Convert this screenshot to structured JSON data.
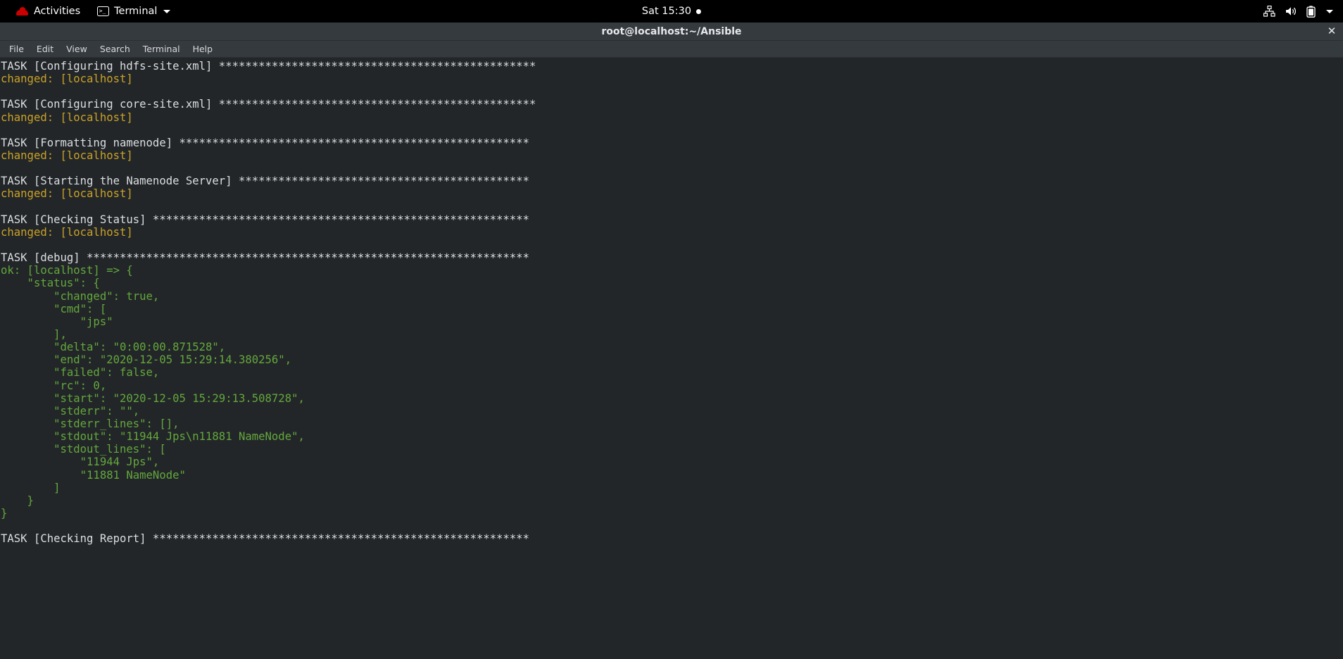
{
  "topbar": {
    "activities_label": "Activities",
    "app_menu_label": "Terminal",
    "app_icon": "terminal-icon",
    "distro_icon": "redhat-logo-icon",
    "clock": "Sat 15:30",
    "notification_indicator": "notification-dot",
    "status_icons": [
      "network-wired-icon",
      "volume-icon",
      "battery-icon",
      "chevron-down-icon"
    ],
    "background": "#000000"
  },
  "window": {
    "title": "root@localhost:~/Ansible",
    "close_label": "✕",
    "titlebar_background": "#353a3f"
  },
  "menubar": {
    "items": [
      {
        "label": "File"
      },
      {
        "label": "Edit"
      },
      {
        "label": "View"
      },
      {
        "label": "Search"
      },
      {
        "label": "Terminal"
      },
      {
        "label": "Help"
      }
    ]
  },
  "terminal": {
    "background": "#232629",
    "colors": {
      "default": "#d0d0d0",
      "task_header": "#dcdfe1",
      "changed": "#c9a227",
      "ok_debug": "#63a83c"
    },
    "lines": [
      {
        "segments": [
          {
            "text": "TASK [Configuring hdfs-site.xml] ************************************************",
            "color": "white"
          }
        ]
      },
      {
        "segments": [
          {
            "text": "changed: [localhost]",
            "color": "yellow"
          }
        ]
      },
      {
        "segments": [
          {
            "text": "",
            "color": "blank"
          }
        ]
      },
      {
        "segments": [
          {
            "text": "TASK [Configuring core-site.xml] ************************************************",
            "color": "white"
          }
        ]
      },
      {
        "segments": [
          {
            "text": "changed: [localhost]",
            "color": "yellow"
          }
        ]
      },
      {
        "segments": [
          {
            "text": "",
            "color": "blank"
          }
        ]
      },
      {
        "segments": [
          {
            "text": "TASK [Formatting namenode] *****************************************************",
            "color": "white"
          }
        ]
      },
      {
        "segments": [
          {
            "text": "changed: [localhost]",
            "color": "yellow"
          }
        ]
      },
      {
        "segments": [
          {
            "text": "",
            "color": "blank"
          }
        ]
      },
      {
        "segments": [
          {
            "text": "TASK [Starting the Namenode Server] ********************************************",
            "color": "white"
          }
        ]
      },
      {
        "segments": [
          {
            "text": "changed: [localhost]",
            "color": "yellow"
          }
        ]
      },
      {
        "segments": [
          {
            "text": "",
            "color": "blank"
          }
        ]
      },
      {
        "segments": [
          {
            "text": "TASK [Checking Status] *********************************************************",
            "color": "white"
          }
        ]
      },
      {
        "segments": [
          {
            "text": "changed: [localhost]",
            "color": "yellow"
          }
        ]
      },
      {
        "segments": [
          {
            "text": "",
            "color": "blank"
          }
        ]
      },
      {
        "segments": [
          {
            "text": "TASK [debug] *******************************************************************",
            "color": "white"
          }
        ]
      },
      {
        "segments": [
          {
            "text": "ok: [localhost] => {",
            "color": "green"
          }
        ]
      },
      {
        "segments": [
          {
            "text": "    \"status\": {",
            "color": "green"
          }
        ]
      },
      {
        "segments": [
          {
            "text": "        \"changed\": true,",
            "color": "green"
          }
        ]
      },
      {
        "segments": [
          {
            "text": "        \"cmd\": [",
            "color": "green"
          }
        ]
      },
      {
        "segments": [
          {
            "text": "            \"jps\"",
            "color": "green"
          }
        ]
      },
      {
        "segments": [
          {
            "text": "        ],",
            "color": "green"
          }
        ]
      },
      {
        "segments": [
          {
            "text": "        \"delta\": \"0:00:00.871528\",",
            "color": "green"
          }
        ]
      },
      {
        "segments": [
          {
            "text": "        \"end\": \"2020-12-05 15:29:14.380256\",",
            "color": "green"
          }
        ]
      },
      {
        "segments": [
          {
            "text": "        \"failed\": false,",
            "color": "green"
          }
        ]
      },
      {
        "segments": [
          {
            "text": "        \"rc\": 0,",
            "color": "green"
          }
        ]
      },
      {
        "segments": [
          {
            "text": "        \"start\": \"2020-12-05 15:29:13.508728\",",
            "color": "green"
          }
        ]
      },
      {
        "segments": [
          {
            "text": "        \"stderr\": \"\",",
            "color": "green"
          }
        ]
      },
      {
        "segments": [
          {
            "text": "        \"stderr_lines\": [],",
            "color": "green"
          }
        ]
      },
      {
        "segments": [
          {
            "text": "        \"stdout\": \"11944 Jps\\n11881 NameNode\",",
            "color": "green"
          }
        ]
      },
      {
        "segments": [
          {
            "text": "        \"stdout_lines\": [",
            "color": "green"
          }
        ]
      },
      {
        "segments": [
          {
            "text": "            \"11944 Jps\",",
            "color": "green"
          }
        ]
      },
      {
        "segments": [
          {
            "text": "            \"11881 NameNode\"",
            "color": "green"
          }
        ]
      },
      {
        "segments": [
          {
            "text": "        ]",
            "color": "green"
          }
        ]
      },
      {
        "segments": [
          {
            "text": "    }",
            "color": "green"
          }
        ]
      },
      {
        "segments": [
          {
            "text": "}",
            "color": "green"
          }
        ]
      },
      {
        "segments": [
          {
            "text": "",
            "color": "blank"
          }
        ]
      },
      {
        "segments": [
          {
            "text": "TASK [Checking Report] *********************************************************",
            "color": "white"
          }
        ]
      }
    ]
  }
}
